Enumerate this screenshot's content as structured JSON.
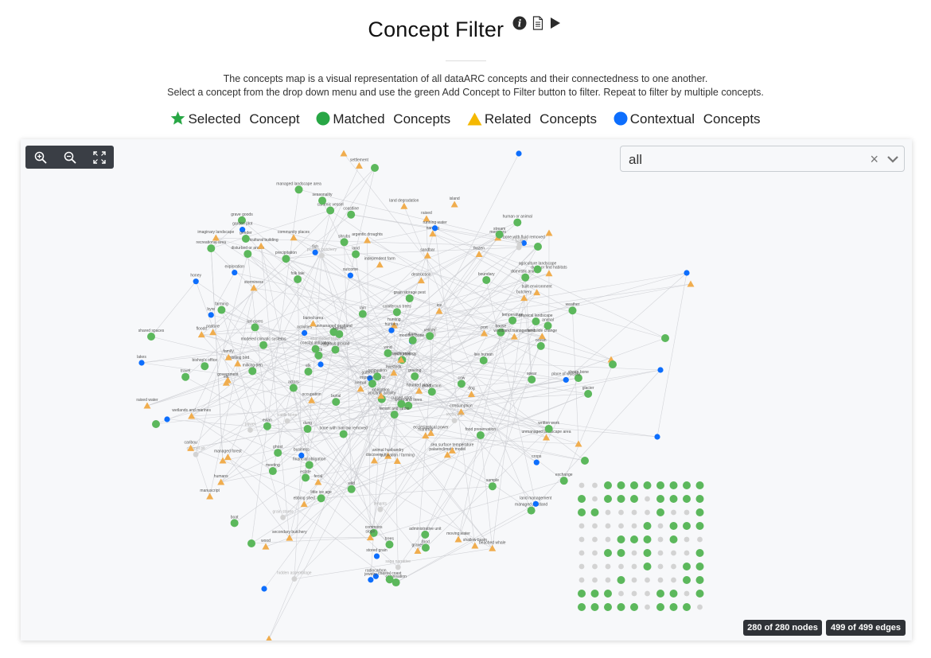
{
  "header": {
    "title": "Concept Filter",
    "icons": [
      "info-icon",
      "document-icon",
      "play-icon"
    ]
  },
  "description": {
    "line1": "The concepts map is a visual representation of all dataARC concepts and their connectedness to one another.",
    "line2": "Select a concept from the drop down menu and use the green Add Concept to Filter button to filter. Repeat to filter by multiple concepts."
  },
  "legend": {
    "selected": "Selected Concept",
    "matched": "Matched Concepts",
    "related": "Related Concepts",
    "contextual": "Contextual Concepts"
  },
  "colors": {
    "selected": "#28a745",
    "matched": "#5cb85c",
    "related": "#f0ad4e",
    "contextual": "#0d6efd",
    "inactive": "#d3d3d3",
    "toolbar": "#3a3e45"
  },
  "toolbar": {
    "zoom_in": "zoom-in-icon",
    "zoom_out": "zoom-out-icon",
    "fullscreen": "fullscreen-icon"
  },
  "filter": {
    "value": "all"
  },
  "stats": {
    "nodes": "280 of 280 nodes",
    "edges": "499 of 499 edges"
  },
  "graph_labels": [
    "sheep bone",
    "graves",
    "secondary butchery",
    "pasture",
    "grain storage pest",
    "caramic vessel",
    "primary butchery",
    "hunting",
    "butchery",
    "honey",
    "business",
    "bone with marrow removed",
    "cattle bone",
    "byre",
    "consumption",
    "milking pen",
    "recourses",
    "grain stores",
    "elk",
    "wild",
    "ebbing shed",
    "colonisation",
    "frozen",
    "whistling bird",
    "port",
    "commons",
    "fecal",
    "modified bone",
    "food preservation",
    "exchange",
    "unmanaged pastland",
    "abandoned place",
    "bone with fluid removed",
    "domestic animal",
    "cow",
    "spear",
    "argentic droughts",
    "coastal coast",
    "boat",
    "gathering",
    "grave goods",
    "luck",
    "farming",
    "animal husbandry",
    "unmanaged landscape area",
    "shrubs",
    "managed pastland",
    "managed landscape area",
    "sheeping",
    "animal",
    "stored grain",
    "dung",
    "boundary",
    "disturbed or arable",
    "land",
    "hidden assemblage",
    "garden plot",
    "administrative unit",
    "government",
    "house",
    "occupation",
    "family",
    "independent farm",
    "dog",
    "food",
    "trees",
    "crops",
    "dung or find habitats",
    "livestock",
    "exploration",
    "production",
    "wood and trees",
    "recreational area",
    "mammal",
    "tenants",
    "managed forest",
    "ghost",
    "saga narrative",
    "beached whale",
    "ecclesiastical power",
    "tenant and farms",
    "precipitation",
    "grazing",
    "improved land",
    "burial",
    "built environment",
    "charnel pit",
    "raised",
    "estate",
    "elk",
    "community places",
    "field",
    "power",
    "live human",
    "wood",
    "settlement",
    "cultivation / farming",
    "land management",
    "agricultural building",
    "caribou",
    "ice",
    "evian",
    "activities",
    "destruction",
    "farm",
    "renovation",
    "kernal",
    "vellum",
    "physical landscape",
    "sample",
    "naming",
    "palaeoclimate model",
    "woodland management",
    "land degradation",
    "religious ground",
    "buried area",
    "discovery",
    "gender",
    "tephrochronology",
    "humans",
    "hunters",
    "travel",
    "monsters",
    "agriculture landscape",
    "rain",
    "weather",
    "recording",
    "human or animal",
    "volcanic activity",
    "rock",
    "actors",
    "haunted place",
    "wetlands and marines",
    "bishop's office",
    "imaginary landscape",
    "landslide change",
    "coniferous trees",
    "coastline",
    "modeled climatic systems",
    "cursed spot",
    "financial obligation",
    "hay mix",
    "place of worship",
    "written work",
    "manuscript",
    "glacier",
    "folk tale",
    "moving water",
    "radiocarbon",
    "little ice age",
    "jewelry",
    "fish",
    "island",
    "ocean",
    "outcome",
    "shallow basin",
    "sandbar",
    "wind",
    "obligation",
    "running water",
    "stream",
    "ice cores",
    "floods",
    "meeting",
    "seasonality",
    "slope",
    "temperature",
    "storminess",
    "coastal obligation",
    "sea surface temperature",
    "shared spaces",
    "lakes",
    "raised water"
  ]
}
